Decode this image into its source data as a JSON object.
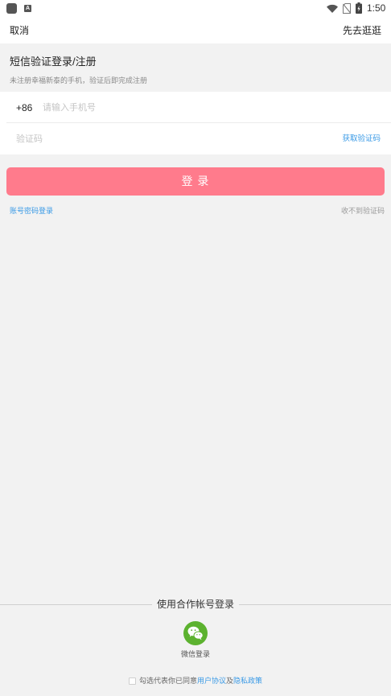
{
  "status_bar": {
    "time": "1:50",
    "notification_icon_letter": "A",
    "icons": [
      "app-icon",
      "notification-a-icon",
      "wifi-icon",
      "no-sim-icon",
      "battery-charging-icon"
    ]
  },
  "header": {
    "cancel_label": "取消",
    "skip_label": "先去逛逛"
  },
  "sms_login": {
    "title": "短信验证登录/注册",
    "subtitle": "未注册幸福新泰的手机，验证后即完成注册",
    "country_code": "+86",
    "phone_placeholder": "请输入手机号",
    "phone_value": "",
    "code_placeholder": "验证码",
    "code_value": "",
    "get_code_label": "获取验证码",
    "login_button_label": "登 录"
  },
  "links": {
    "password_login": "账号密码登录",
    "no_code": "收不到验证码"
  },
  "third_party": {
    "divider_label": "使用合作帐号登录",
    "wechat_icon": "wechat-icon",
    "wechat_label": "微信登录"
  },
  "agreement": {
    "checked": false,
    "prefix": "勾选代表你已同意",
    "user_agreement": "用户协议",
    "conjunction": "及",
    "privacy_policy": "隐私政策"
  },
  "colors": {
    "login_button": "#ff7b8c",
    "link_blue": "#3a9ae6",
    "wechat_green": "#5cb22f",
    "page_background": "#f2f2f2"
  }
}
